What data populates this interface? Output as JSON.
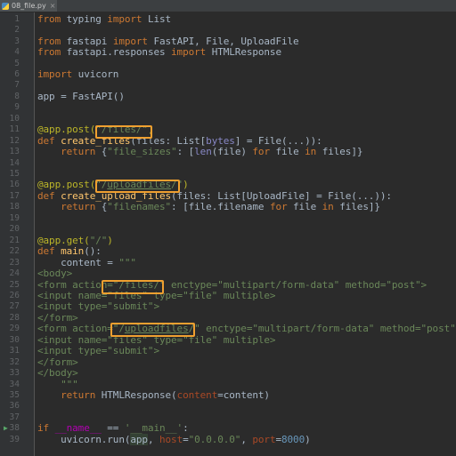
{
  "tab": {
    "filename": "08_file.py",
    "close": "×"
  },
  "lines": [
    {
      "n": "1"
    },
    {
      "n": "2"
    },
    {
      "n": "3"
    },
    {
      "n": "4"
    },
    {
      "n": "5"
    },
    {
      "n": "6"
    },
    {
      "n": "7"
    },
    {
      "n": "8"
    },
    {
      "n": "9"
    },
    {
      "n": "10"
    },
    {
      "n": "11"
    },
    {
      "n": "12"
    },
    {
      "n": "13"
    },
    {
      "n": "14"
    },
    {
      "n": "15"
    },
    {
      "n": "16"
    },
    {
      "n": "17"
    },
    {
      "n": "18"
    },
    {
      "n": "19"
    },
    {
      "n": "20"
    },
    {
      "n": "21"
    },
    {
      "n": "22"
    },
    {
      "n": "23"
    },
    {
      "n": "24"
    },
    {
      "n": "25"
    },
    {
      "n": "26"
    },
    {
      "n": "27"
    },
    {
      "n": "28"
    },
    {
      "n": "29"
    },
    {
      "n": "30"
    },
    {
      "n": "31"
    },
    {
      "n": "32"
    },
    {
      "n": "33"
    },
    {
      "n": "34"
    },
    {
      "n": "35"
    },
    {
      "n": "36"
    },
    {
      "n": "37"
    },
    {
      "n": "38"
    },
    {
      "n": "39"
    }
  ],
  "code": {
    "l1": [
      {
        "t": "from ",
        "c": "kw"
      },
      {
        "t": "typing "
      },
      {
        "t": "import ",
        "c": "kw"
      },
      {
        "t": "List"
      }
    ],
    "l3": [
      {
        "t": "from ",
        "c": "kw"
      },
      {
        "t": "fastapi "
      },
      {
        "t": "import ",
        "c": "kw"
      },
      {
        "t": "FastAPI, File, UploadFile"
      }
    ],
    "l4": [
      {
        "t": "from ",
        "c": "kw"
      },
      {
        "t": "fastapi.responses "
      },
      {
        "t": "import ",
        "c": "kw"
      },
      {
        "t": "HTMLResponse"
      }
    ],
    "l6": [
      {
        "t": "import ",
        "c": "kw"
      },
      {
        "t": "uvicorn"
      }
    ],
    "l8": [
      {
        "t": "app = FastAPI()"
      }
    ],
    "l11": [
      {
        "t": "@app.post(",
        "c": "dec"
      },
      {
        "t": "\"/files/\"",
        "c": "str"
      },
      {
        "t": ")",
        "c": "dec"
      }
    ],
    "l12": [
      {
        "t": "def ",
        "c": "kw"
      },
      {
        "t": "create_files",
        "c": "fn"
      },
      {
        "t": "(files: List["
      },
      {
        "t": "bytes",
        "c": "builtin"
      },
      {
        "t": "] = File(...)):"
      }
    ],
    "l13": [
      {
        "t": "    "
      },
      {
        "t": "return ",
        "c": "kw"
      },
      {
        "t": "{"
      },
      {
        "t": "\"file_sizes\"",
        "c": "str"
      },
      {
        "t": ": ["
      },
      {
        "t": "len",
        "c": "builtin"
      },
      {
        "t": "(file) "
      },
      {
        "t": "for ",
        "c": "kw"
      },
      {
        "t": "file "
      },
      {
        "t": "in ",
        "c": "kw"
      },
      {
        "t": "files]}"
      }
    ],
    "l16": [
      {
        "t": "@app.post(",
        "c": "dec"
      },
      {
        "t": "\"/",
        "c": "str"
      },
      {
        "t": "uploadfiles",
        "c": "str u"
      },
      {
        "t": "/\"",
        "c": "str"
      },
      {
        "t": ")",
        "c": "dec"
      }
    ],
    "l17": [
      {
        "t": "def ",
        "c": "kw"
      },
      {
        "t": "create_upload_files",
        "c": "fn"
      },
      {
        "t": "(files: List[UploadFile] = File(...)):"
      }
    ],
    "l18": [
      {
        "t": "    "
      },
      {
        "t": "return ",
        "c": "kw"
      },
      {
        "t": "{"
      },
      {
        "t": "\"filenames\"",
        "c": "str"
      },
      {
        "t": ": [file.filename "
      },
      {
        "t": "for ",
        "c": "kw"
      },
      {
        "t": "file "
      },
      {
        "t": "in ",
        "c": "kw"
      },
      {
        "t": "files]}"
      }
    ],
    "l21": [
      {
        "t": "@app.get(",
        "c": "dec"
      },
      {
        "t": "\"/\"",
        "c": "str"
      },
      {
        "t": ")",
        "c": "dec"
      }
    ],
    "l22": [
      {
        "t": "def ",
        "c": "kw"
      },
      {
        "t": "main",
        "c": "fn"
      },
      {
        "t": "():"
      }
    ],
    "l23": [
      {
        "t": "    content = "
      },
      {
        "t": "\"\"\"",
        "c": "str"
      }
    ],
    "l24": [
      {
        "t": "<body>",
        "c": "str"
      }
    ],
    "l25": [
      {
        "t": "<form action=\"/files/\" enctype=\"multipart/form-data\" method=\"post\">",
        "c": "str"
      }
    ],
    "l26": [
      {
        "t": "<input name=\"files\" type=\"file\" multiple>",
        "c": "str"
      }
    ],
    "l27": [
      {
        "t": "<input type=\"submit\">",
        "c": "str"
      }
    ],
    "l28": [
      {
        "t": "</form>",
        "c": "str"
      }
    ],
    "l29": [
      {
        "t": "<form action=\"/",
        "c": "str"
      },
      {
        "t": "uploadfiles",
        "c": "str u"
      },
      {
        "t": "/\" enctype=\"multipart/form-data\" method=\"post\">",
        "c": "str"
      }
    ],
    "l30": [
      {
        "t": "<input name=\"files\" type=\"file\" multiple>",
        "c": "str"
      }
    ],
    "l31": [
      {
        "t": "<input type=\"submit\">",
        "c": "str"
      }
    ],
    "l32": [
      {
        "t": "</form>",
        "c": "str"
      }
    ],
    "l33": [
      {
        "t": "</body>",
        "c": "str"
      }
    ],
    "l34": [
      {
        "t": "    \"\"\"",
        "c": "str"
      }
    ],
    "l35": [
      {
        "t": "    "
      },
      {
        "t": "return ",
        "c": "kw"
      },
      {
        "t": "HTMLResponse(",
        "c": ""
      },
      {
        "t": "content",
        "c": "kwarg"
      },
      {
        "t": "=content)"
      }
    ],
    "l38": [
      {
        "t": "if ",
        "c": "kw"
      },
      {
        "t": "__name__",
        "c": "dunder"
      },
      {
        "t": " == "
      },
      {
        "t": "'__main__'",
        "c": "str"
      },
      {
        "t": ":"
      }
    ],
    "l39": [
      {
        "t": "    uvicorn.run("
      },
      {
        "t": "app",
        "c": "cursor-hl"
      },
      {
        "t": ", "
      },
      {
        "t": "host",
        "c": "kwarg"
      },
      {
        "t": "="
      },
      {
        "t": "\"0.0.0.0\"",
        "c": "str"
      },
      {
        "t": ", "
      },
      {
        "t": "port",
        "c": "kwarg"
      },
      {
        "t": "="
      },
      {
        "t": "8000",
        "c": "num"
      },
      {
        "t": ")"
      }
    ]
  },
  "run_marker": "▶"
}
